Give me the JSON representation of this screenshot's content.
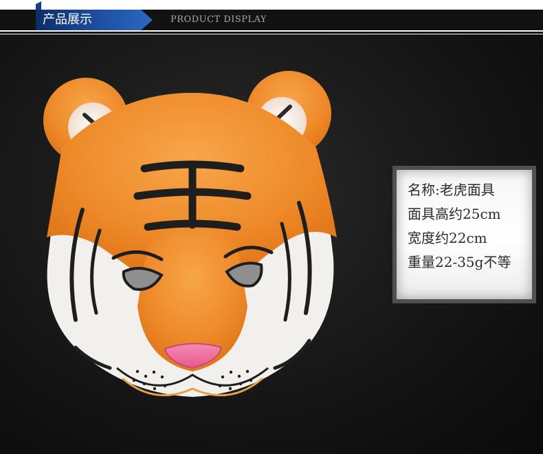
{
  "header": {
    "title": "产品展示",
    "subtitle": "PRODUCT DISPLAY",
    "accent_color": "#1f4fa0"
  },
  "product": {
    "image_subject": "tiger-mask"
  },
  "specs": [
    {
      "text": "名称:老虎面具"
    },
    {
      "text": "面具高约25cm"
    },
    {
      "text": "宽度约22cm"
    },
    {
      "text": "重量22-35g不等"
    }
  ]
}
